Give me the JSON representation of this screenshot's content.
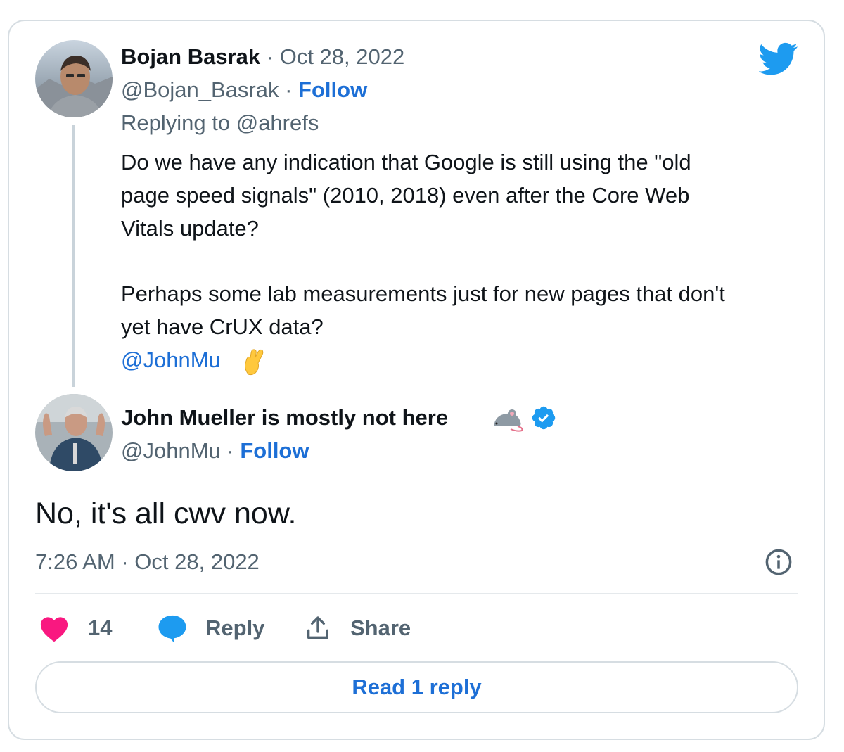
{
  "reply_tweet": {
    "author_name": "Bojan Basrak",
    "date": "Oct 28, 2022",
    "handle": "@Bojan_Basrak",
    "follow_label": "Follow",
    "replying_to_label": "Replying to",
    "replying_to_handle": "@ahrefs",
    "text_lines": [
      "Do we have any indication that Google is still using the \"old",
      "page speed signals\" (2010, 2018) even after the Core Web",
      "Vitals update?",
      "Perhaps some lab measurements just for new pages that don't",
      "yet have CrUX data?"
    ],
    "mention": "@JohnMu",
    "emoji": "crossed-fingers-icon"
  },
  "main_tweet": {
    "author_name": "John Mueller is mostly not here",
    "handle": "@JohnMu",
    "follow_label": "Follow",
    "text": "No, it's all cwv now.",
    "timestamp": "7:26 AM · Oct 28, 2022"
  },
  "actions": {
    "like_count": "14",
    "reply_label": "Reply",
    "share_label": "Share"
  },
  "read_reply_label": "Read 1 reply",
  "colors": {
    "twitter_blue": "#1d9bf0",
    "link": "#1d6fd6",
    "heart": "#f91880",
    "muted": "#536471",
    "border": "#d6dde2"
  }
}
